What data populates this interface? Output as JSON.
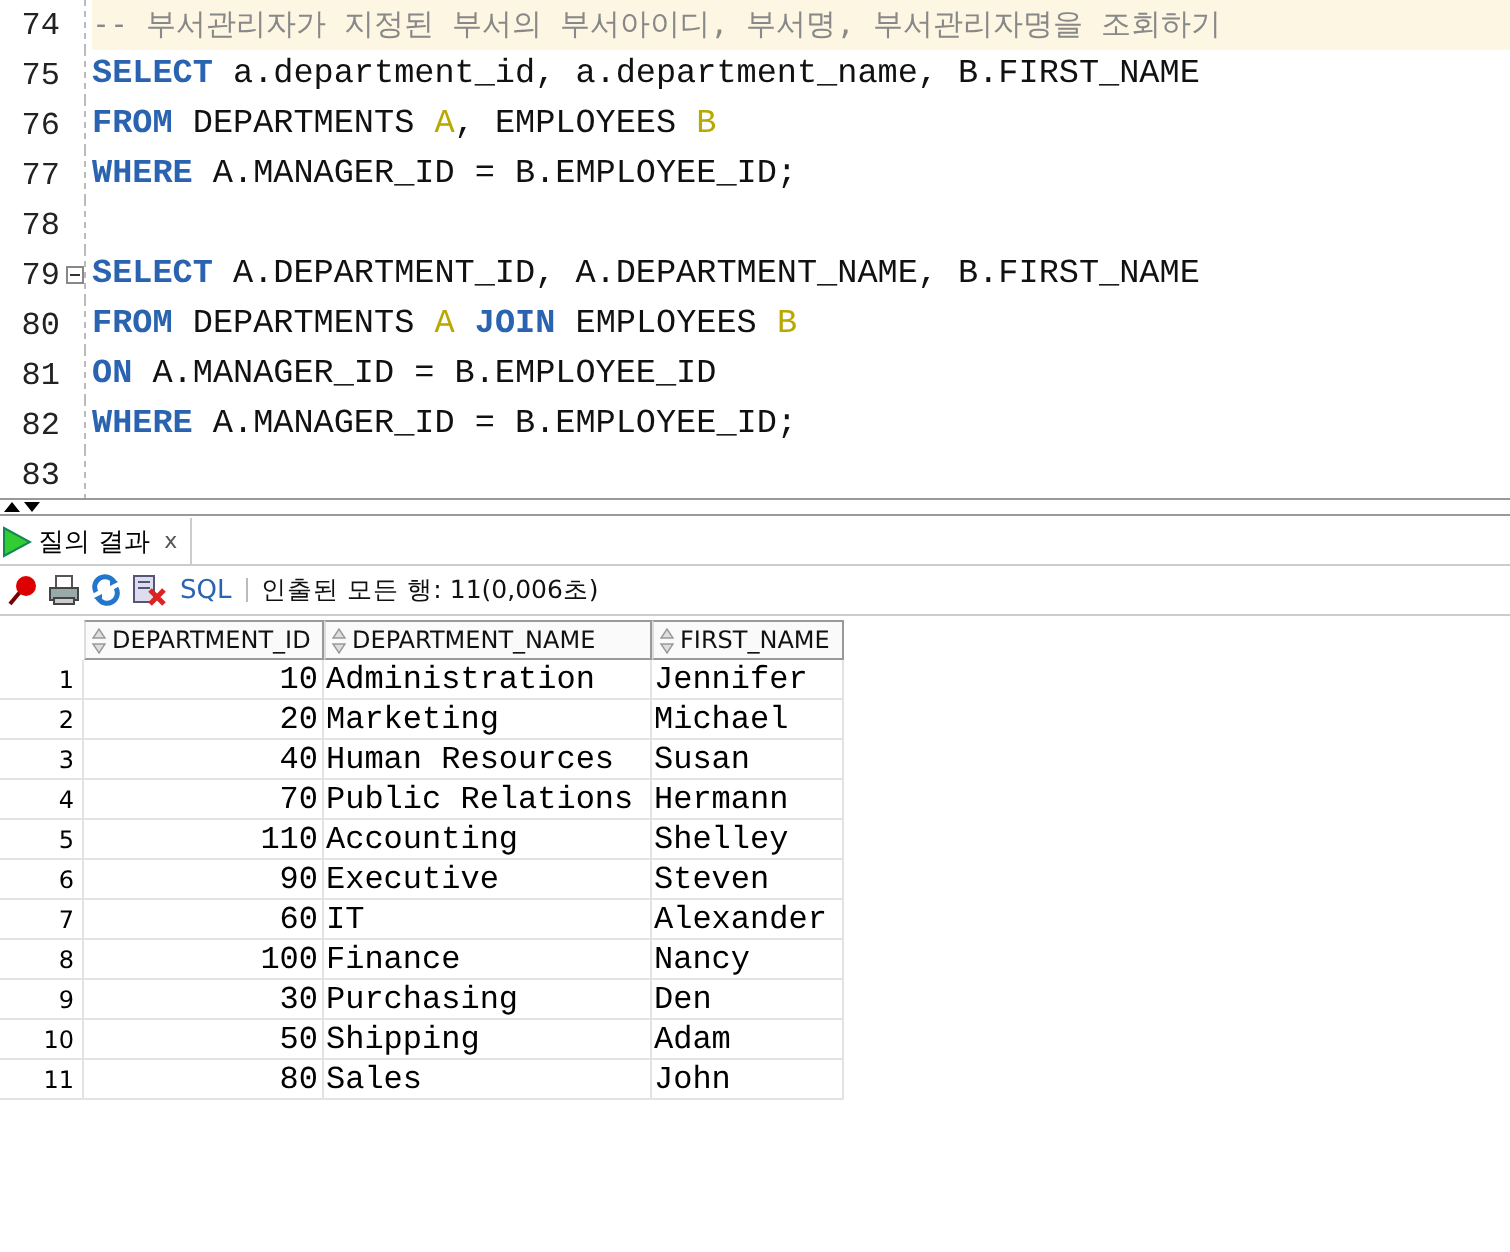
{
  "editor": {
    "lines": [
      {
        "number": "74",
        "current": true,
        "fold": false,
        "tokens": [
          {
            "kind": "comment",
            "text": "-- 부서관리자가 지정된 부서의 부서아이디, 부서명, 부서관리자명을 조회하기"
          }
        ]
      },
      {
        "number": "75",
        "current": false,
        "fold": false,
        "tokens": [
          {
            "kind": "keyword",
            "text": "SELECT"
          },
          {
            "kind": "plain",
            "text": " a.department_id, a.department_name, B.FIRST_NAME"
          }
        ]
      },
      {
        "number": "76",
        "current": false,
        "fold": false,
        "tokens": [
          {
            "kind": "keyword",
            "text": "FROM"
          },
          {
            "kind": "plain",
            "text": " DEPARTMENTS "
          },
          {
            "kind": "alias",
            "text": "A"
          },
          {
            "kind": "plain",
            "text": ", EMPLOYEES "
          },
          {
            "kind": "alias",
            "text": "B"
          }
        ]
      },
      {
        "number": "77",
        "current": false,
        "fold": false,
        "tokens": [
          {
            "kind": "keyword",
            "text": "WHERE"
          },
          {
            "kind": "plain",
            "text": " A.MANAGER_ID = B.EMPLOYEE_ID;"
          }
        ]
      },
      {
        "number": "78",
        "current": false,
        "fold": false
      },
      {
        "number": "79",
        "current": false,
        "fold": true,
        "tokens": [
          {
            "kind": "keyword",
            "text": "SELECT"
          },
          {
            "kind": "plain",
            "text": " A.DEPARTMENT_ID, A.DEPARTMENT_NAME, B.FIRST_NAME"
          }
        ]
      },
      {
        "number": "80",
        "current": false,
        "fold": false,
        "tokens": [
          {
            "kind": "keyword",
            "text": "FROM"
          },
          {
            "kind": "plain",
            "text": " DEPARTMENTS "
          },
          {
            "kind": "alias",
            "text": "A "
          },
          {
            "kind": "keyword",
            "text": "JOIN"
          },
          {
            "kind": "plain",
            "text": " EMPLOYEES "
          },
          {
            "kind": "alias",
            "text": "B"
          }
        ]
      },
      {
        "number": "81",
        "current": false,
        "fold": false,
        "tokens": [
          {
            "kind": "keyword",
            "text": "ON"
          },
          {
            "kind": "plain",
            "text": " A.MANAGER_ID = B.EMPLOYEE_ID"
          }
        ]
      },
      {
        "number": "82",
        "current": false,
        "fold": false,
        "tokens": [
          {
            "kind": "keyword",
            "text": "WHERE"
          },
          {
            "kind": "plain",
            "text": " A.MANAGER_ID = B.EMPLOYEE_ID;"
          }
        ]
      },
      {
        "number": "83",
        "current": false,
        "fold": false
      }
    ]
  },
  "tabs": [
    {
      "label": "질의 결과",
      "close": "x",
      "selected": true
    }
  ],
  "toolbar": {
    "sql_label": "SQL",
    "status": "인출된 모든 행: 11(0,006초)"
  },
  "grid": {
    "columns": [
      "DEPARTMENT_ID",
      "DEPARTMENT_NAME",
      "FIRST_NAME"
    ],
    "rows": [
      {
        "number": "1",
        "cells": [
          "10",
          "Administration",
          "Jennifer"
        ]
      },
      {
        "number": "2",
        "cells": [
          "20",
          "Marketing",
          "Michael"
        ]
      },
      {
        "number": "3",
        "cells": [
          "40",
          "Human Resources",
          "Susan"
        ]
      },
      {
        "number": "4",
        "cells": [
          "70",
          "Public Relations",
          "Hermann"
        ]
      },
      {
        "number": "5",
        "cells": [
          "110",
          "Accounting",
          "Shelley"
        ]
      },
      {
        "number": "6",
        "cells": [
          "90",
          "Executive",
          "Steven"
        ]
      },
      {
        "number": "7",
        "cells": [
          "60",
          "IT",
          "Alexander"
        ]
      },
      {
        "number": "8",
        "cells": [
          "100",
          "Finance",
          "Nancy"
        ]
      },
      {
        "number": "9",
        "cells": [
          "30",
          "Purchasing",
          "Den"
        ]
      },
      {
        "number": "10",
        "cells": [
          "50",
          "Shipping",
          "Adam"
        ]
      },
      {
        "number": "11",
        "cells": [
          "80",
          "Sales",
          "John"
        ]
      }
    ]
  }
}
